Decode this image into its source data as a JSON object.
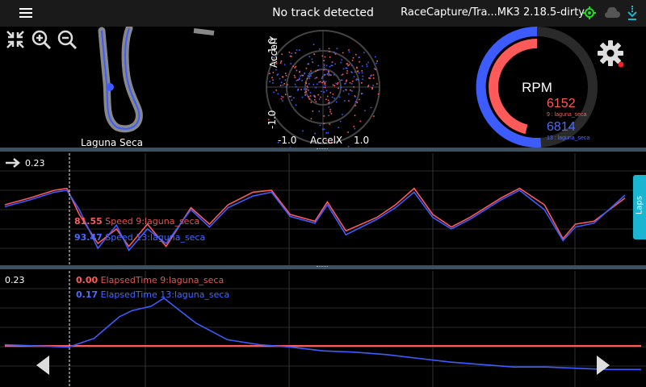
{
  "topbar": {
    "status": "No track detected",
    "device": "RaceCapture/Tra...MK3 2.18.5-dirty"
  },
  "icons": {
    "menu": "menu-icon",
    "gps": "gps-icon",
    "cloud": "cloud-icon",
    "download": "download-icon",
    "compress": "compress-icon",
    "zoom_in": "zoom-in-icon",
    "zoom_out": "zoom-out-icon",
    "settings": "gear-icon"
  },
  "colors": {
    "red": "#ff5a5a",
    "blue": "#3d5cff",
    "accent": "#19b5d1",
    "gps_green": "#22dd22"
  },
  "track": {
    "name": "Laguna Seca"
  },
  "gg": {
    "ylabel": "AccelY",
    "xlabel": "AccelX",
    "y_top": "1.0",
    "y_bottom": "-1.0",
    "x_left": "-1.0",
    "x_right": "1.0"
  },
  "rpm": {
    "label": "RPM",
    "lap1_value": "6152",
    "lap1_label": "9 : laguna_seca",
    "lap2_value": "6814",
    "lap2_label": "13 : laguna_seca",
    "max": 10000
  },
  "laps_tab": "Laps",
  "chart1": {
    "cursor_value": "0.23",
    "readouts": [
      {
        "value": "81.55",
        "label": "Speed 9:laguna_seca"
      },
      {
        "value": "93.47",
        "label": "Speed 13:laguna_seca"
      }
    ]
  },
  "chart2": {
    "cursor_value": "0.23",
    "readouts": [
      {
        "value": "0.00",
        "label": "ElapsedTime 9:laguna_seca"
      },
      {
        "value": "0.17",
        "label": "ElapsedTime 13:laguna_seca"
      }
    ]
  },
  "chart_data": [
    {
      "type": "line",
      "title": "",
      "xlabel": "",
      "ylabel": "",
      "x": [
        0,
        0.04,
        0.08,
        0.1,
        0.12,
        0.15,
        0.18,
        0.2,
        0.23,
        0.26,
        0.3,
        0.33,
        0.36,
        0.4,
        0.43,
        0.46,
        0.5,
        0.52,
        0.55,
        0.6,
        0.63,
        0.66,
        0.69,
        0.72,
        0.75,
        0.8,
        0.83,
        0.87,
        0.9,
        0.92,
        0.95,
        1.0
      ],
      "series": [
        {
          "name": "Speed 9:laguna_seca",
          "values": [
            0.55,
            0.62,
            0.7,
            0.72,
            0.45,
            0.15,
            0.3,
            0.12,
            0.35,
            0.12,
            0.52,
            0.35,
            0.55,
            0.68,
            0.7,
            0.45,
            0.38,
            0.58,
            0.28,
            0.42,
            0.55,
            0.72,
            0.45,
            0.32,
            0.42,
            0.62,
            0.72,
            0.55,
            0.2,
            0.35,
            0.38,
            0.62
          ]
        },
        {
          "name": "Speed 13:laguna_seca",
          "values": [
            0.53,
            0.6,
            0.68,
            0.7,
            0.5,
            0.1,
            0.34,
            0.08,
            0.3,
            0.15,
            0.5,
            0.32,
            0.52,
            0.64,
            0.68,
            0.43,
            0.36,
            0.55,
            0.24,
            0.4,
            0.52,
            0.68,
            0.42,
            0.3,
            0.4,
            0.6,
            0.7,
            0.5,
            0.18,
            0.32,
            0.36,
            0.65
          ]
        }
      ]
    },
    {
      "type": "line",
      "title": "",
      "xlabel": "",
      "ylabel": "",
      "x": [
        0,
        0.05,
        0.1,
        0.14,
        0.18,
        0.2,
        0.23,
        0.25,
        0.3,
        0.35,
        0.4,
        0.45,
        0.5,
        0.55,
        0.6,
        0.65,
        0.7,
        0.75,
        0.8,
        0.85,
        0.9,
        0.95,
        1.0
      ],
      "series": [
        {
          "name": "ElapsedTime 9:laguna_seca",
          "values": [
            0.08,
            0.08,
            0.08,
            0.08,
            0.08,
            0.08,
            0.08,
            0.08,
            0.08,
            0.08,
            0.08,
            0.08,
            0.08,
            0.08,
            0.08,
            0.08,
            0.08,
            0.08,
            0.08,
            0.08,
            0.08,
            0.08,
            0.08
          ]
        },
        {
          "name": "ElapsedTime 13:laguna_seca",
          "values": [
            0.1,
            0.08,
            0.06,
            0.2,
            0.55,
            0.65,
            0.72,
            0.85,
            0.45,
            0.18,
            0.1,
            0.06,
            0.0,
            -0.02,
            -0.06,
            -0.12,
            -0.18,
            -0.22,
            -0.26,
            -0.26,
            -0.28,
            -0.3,
            -0.3
          ]
        }
      ]
    }
  ]
}
